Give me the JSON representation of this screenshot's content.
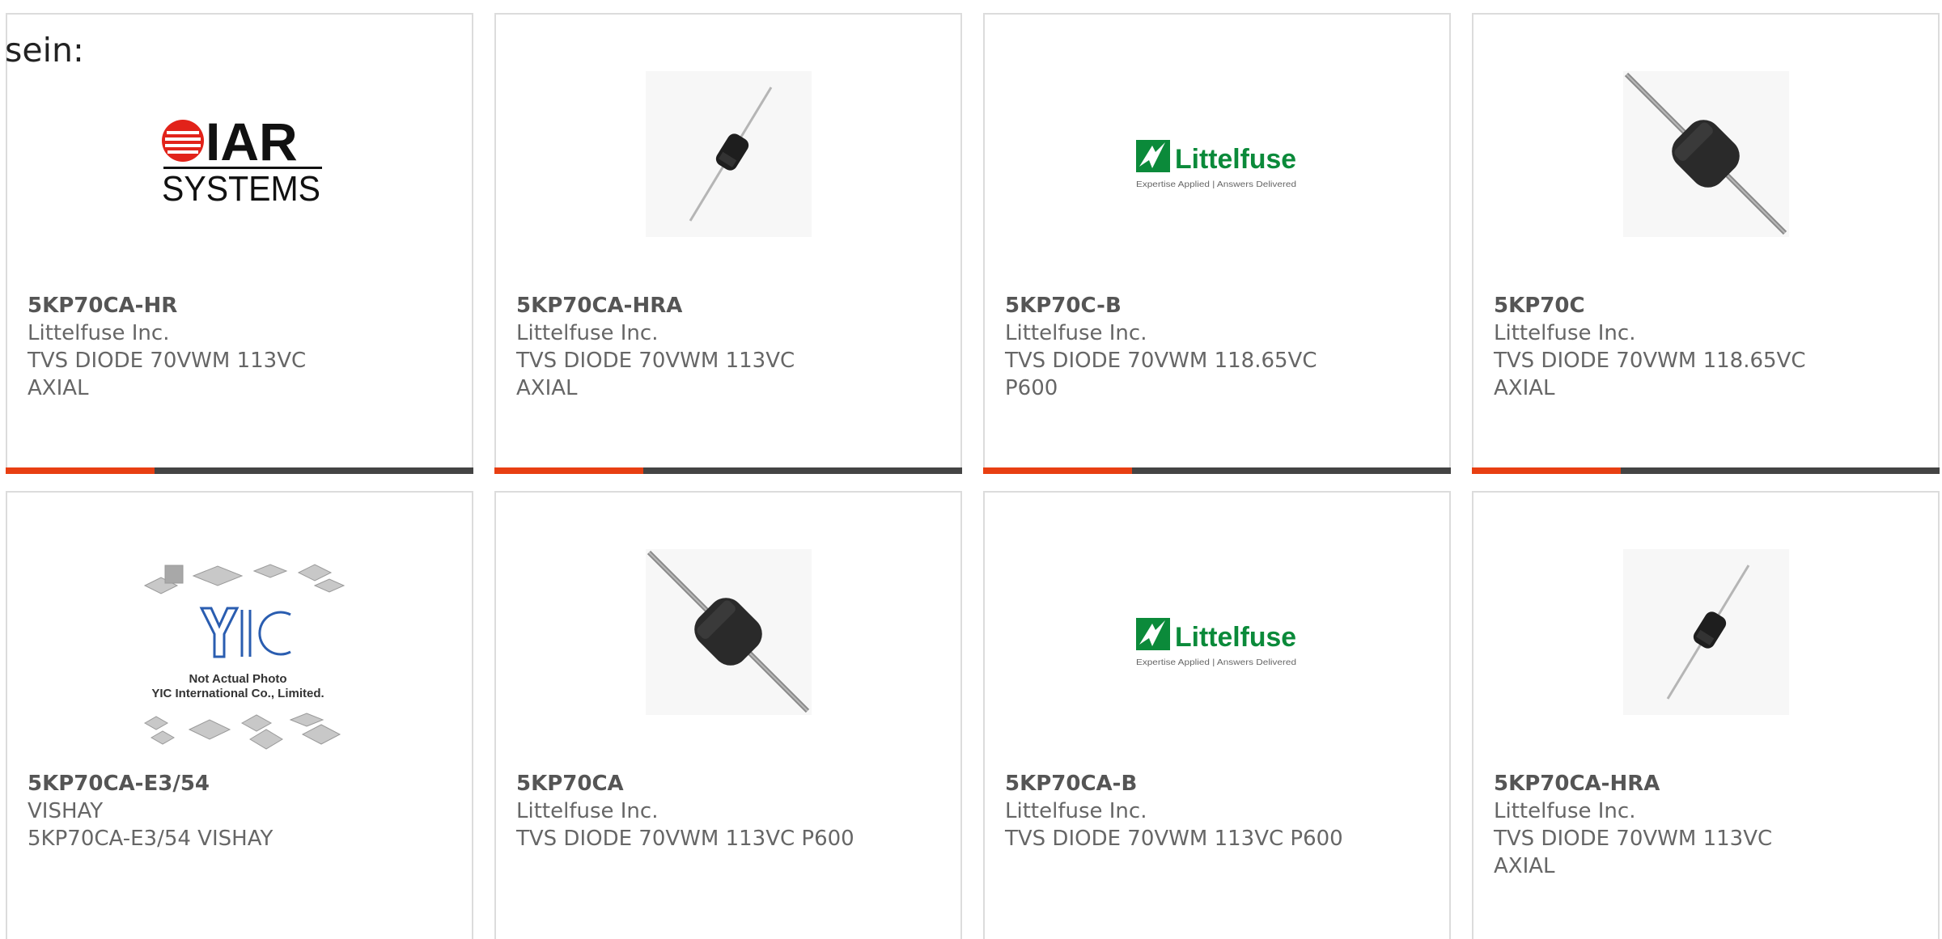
{
  "intro_text": "sein:",
  "colors": {
    "accent": "#e83f12",
    "bar": "#444444",
    "card_border": "#dcdcdc",
    "text": "#666666",
    "littelfuse_green": "#0b8a3a"
  },
  "products": [
    {
      "part_number": "5KP70CA-HR",
      "manufacturer": "Littelfuse Inc.",
      "description": "TVS DIODE 70VWM 113VC AXIAL",
      "image": "iar-systems-logo",
      "logo_text_top": "IAR",
      "logo_text_bottom": "SYSTEMS"
    },
    {
      "part_number": "5KP70CA-HRA",
      "manufacturer": "Littelfuse Inc.",
      "description": "TVS DIODE 70VWM 113VC AXIAL",
      "image": "small-axial-diode-photo"
    },
    {
      "part_number": "5KP70C-B",
      "manufacturer": "Littelfuse Inc.",
      "description": "TVS DIODE 70VWM 118.65VC P600",
      "image": "littelfuse-logo",
      "logo_text": "Littelfuse",
      "logo_tagline": "Expertise Applied | Answers Delivered"
    },
    {
      "part_number": "5KP70C",
      "manufacturer": "Littelfuse Inc.",
      "description": "TVS DIODE 70VWM 118.65VC AXIAL",
      "image": "large-axial-diode-photo"
    },
    {
      "part_number": "5KP70CA-E3/54",
      "manufacturer": "VISHAY",
      "description": "5KP70CA-E3/54 VISHAY",
      "image": "yic-placeholder-photo",
      "logo_text": "YIC",
      "caption_line1": "Not Actual Photo",
      "caption_line2": "YIC International Co., Limited."
    },
    {
      "part_number": "5KP70CA",
      "manufacturer": "Littelfuse Inc.",
      "description": "TVS DIODE 70VWM 113VC P600",
      "image": "large-axial-diode-photo"
    },
    {
      "part_number": "5KP70CA-B",
      "manufacturer": "Littelfuse Inc.",
      "description": "TVS DIODE 70VWM 113VC P600",
      "image": "littelfuse-logo",
      "logo_text": "Littelfuse",
      "logo_tagline": "Expertise Applied | Answers Delivered"
    },
    {
      "part_number": "5KP70CA-HRA",
      "manufacturer": "Littelfuse Inc.",
      "description": "TVS DIODE 70VWM 113VC AXIAL",
      "image": "small-axial-diode-photo"
    }
  ]
}
